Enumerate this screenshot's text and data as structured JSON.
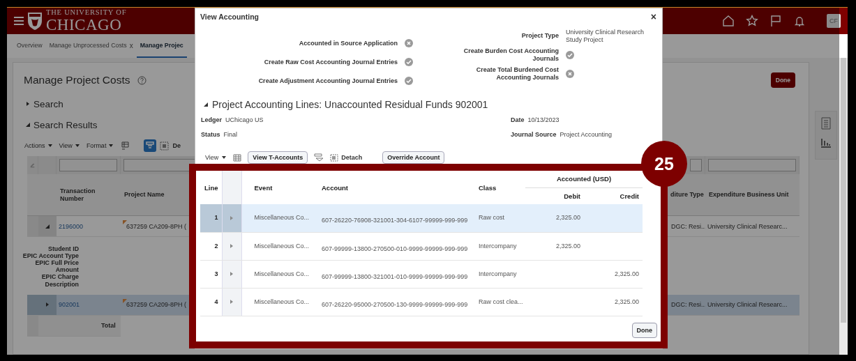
{
  "header": {
    "logo_top": "THE UNIVERSITY OF",
    "logo_bottom": "CHICAGO",
    "avatar": "CF"
  },
  "tabs": [
    {
      "label": "Overview",
      "selected": false
    },
    {
      "label": "Manage Unprocessed Costs",
      "selected": false,
      "close": "x"
    },
    {
      "label": "Manage Projec",
      "selected": true
    }
  ],
  "page": {
    "title": "Manage Project Costs",
    "done": "Done",
    "sections": [
      {
        "label": "Search",
        "expanded": false
      },
      {
        "label": "Search Results",
        "expanded": true
      }
    ],
    "menus": [
      "Actions",
      "View",
      "Format"
    ],
    "toolbar_cut": "De",
    "columns": [
      "Transaction Number",
      "Project Name",
      "diture Type",
      "Expenditure Business Unit"
    ],
    "rows": [
      {
        "number": "2196000",
        "project": "637259 CA209-8PH (",
        "type": "DGC: Resi...",
        "unit": "University Clinical Researc...",
        "expanded": true,
        "selected": false,
        "details": [
          "Student ID",
          "EPIC Account Type",
          "EPIC Full Price Amount",
          "EPIC Charge Description"
        ]
      },
      {
        "number": "902001",
        "project": "637259 CA209-8PH (",
        "type": "DGC: Resi...",
        "unit": "University Clinical Researc...",
        "expanded": false,
        "selected": true
      }
    ],
    "total": "Total"
  },
  "dialog": {
    "title": "View Accounting",
    "close": "×",
    "left_fields": [
      {
        "label": "Accounted in Source Application",
        "complete": false
      },
      {
        "label": "Create Raw Cost Accounting Journal Entries",
        "complete": true
      },
      {
        "label": "Create Adjustment Accounting Journal Entries",
        "complete": true
      }
    ],
    "right_fields": [
      {
        "kind": "text",
        "label": "Project Type",
        "value": "University Clinical Research Study Project"
      },
      {
        "kind": "status",
        "label": "Create Burden Cost Accounting Journals",
        "complete": true
      },
      {
        "kind": "status",
        "label": "Create Total Burdened Cost Accounting Journals",
        "complete": false
      }
    ],
    "section": {
      "title": "Project Accounting Lines: Unaccounted Residual Funds 902001",
      "expanded": true
    },
    "info": [
      {
        "label": "Ledger",
        "value": "UChicago US"
      },
      {
        "label": "Date",
        "value": "10/13/2023"
      },
      {
        "label": "Status",
        "value": "Final"
      },
      {
        "label": "Journal Source",
        "value": "Project Accounting"
      }
    ],
    "toolbar": {
      "view": "View",
      "t_accounts": "View T-Accounts",
      "detach": "Detach",
      "override": "Override Account"
    }
  },
  "callout": {
    "number": "25",
    "columns": {
      "line": "Line",
      "event": "Event",
      "account": "Account",
      "class": "Class",
      "group": "Accounted (USD)",
      "debit": "Debit",
      "credit": "Credit"
    },
    "rows": [
      {
        "line": "1",
        "event": "Miscellaneous Co...",
        "account": "607-26220-76908-321001-304-6107-99999-999-999",
        "class": "Raw cost",
        "debit": "2,325.00",
        "selected": true
      },
      {
        "line": "2",
        "event": "Miscellaneous Co...",
        "account": "607-99999-13800-270500-010-9999-99999-999-999",
        "class": "Intercompany",
        "debit": "2,325.00",
        "selected": false
      },
      {
        "line": "3",
        "event": "Miscellaneous Co...",
        "account": "607-99999-13800-321001-010-9999-99999-999-999",
        "class": "Intercompany",
        "credit": "2,325.00",
        "selected": false
      },
      {
        "line": "4",
        "event": "Miscellaneous Co...",
        "account": "607-26220-95000-270500-130-9999-99999-999-999",
        "class": "Raw cost clea...",
        "credit": "2,325.00",
        "selected": false
      }
    ],
    "done": "Done"
  }
}
